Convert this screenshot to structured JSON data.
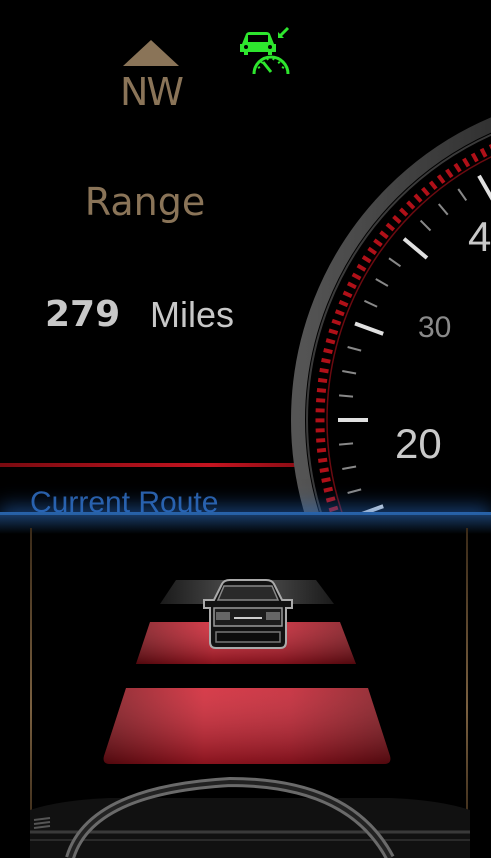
{
  "compass": {
    "heading": "NW"
  },
  "range": {
    "label": "Range",
    "value": "279",
    "unit": "Miles"
  },
  "route": {
    "label": "Current Route"
  },
  "speedometer": {
    "ticks": [
      "20",
      "30",
      "4"
    ]
  },
  "icons": {
    "cruise": "adaptive-cruise-icon",
    "compass": "compass-arrow-icon",
    "vehicle": "lead-vehicle-icon"
  },
  "colors": {
    "accent_bronze": "#8a7458",
    "cruise_green": "#2ee62e",
    "route_blue": "#2a5fa8",
    "gauge_red": "#c41420"
  }
}
